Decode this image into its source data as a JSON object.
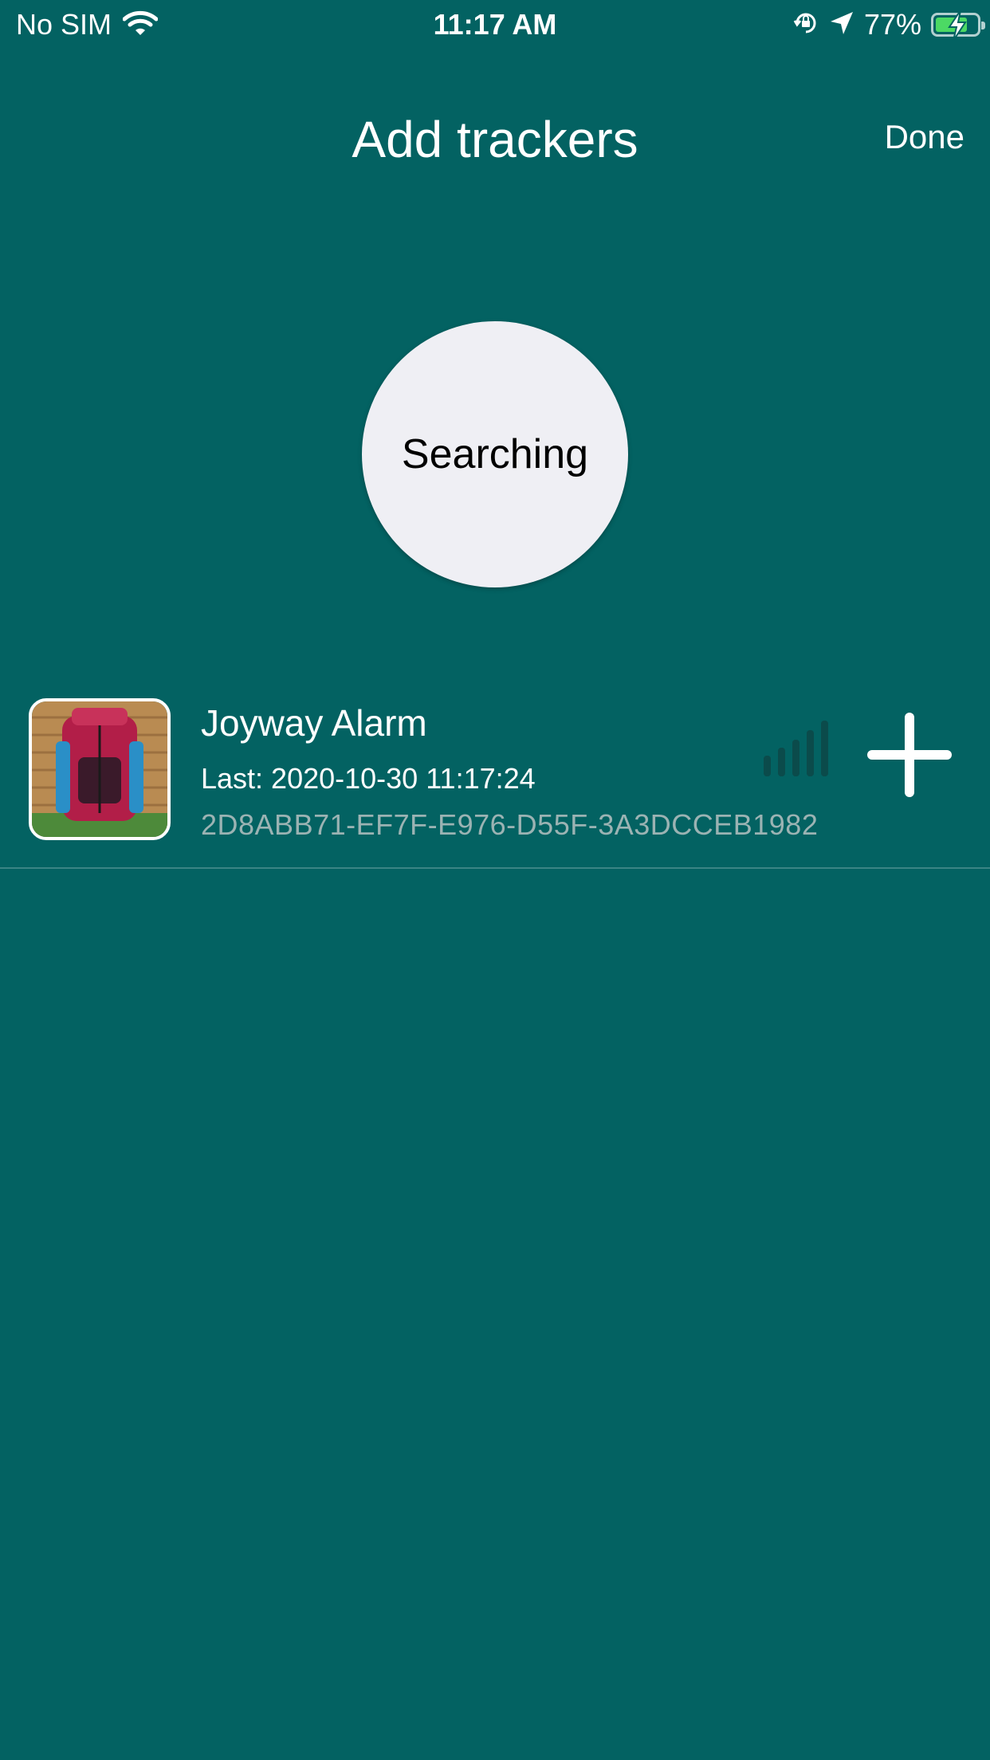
{
  "status_bar": {
    "carrier": "No SIM",
    "time": "11:17 AM",
    "battery_percent": "77%"
  },
  "nav": {
    "title": "Add trackers",
    "done_label": "Done"
  },
  "search": {
    "label": "Searching"
  },
  "trackers": [
    {
      "name": "Joyway Alarm",
      "last_seen": "Last: 2020-10-30 11:17:24",
      "id": "2D8ABB71-EF7F-E976-D55F-3A3DCCEB1982",
      "signal_bars": 0
    }
  ],
  "colors": {
    "background": "#036262",
    "circle": "#efeff4",
    "secondary_text": "#9bb3b3"
  },
  "icons": [
    "wifi-icon",
    "orientation-lock-icon",
    "location-arrow-icon",
    "battery-icon",
    "signal-strength-icon",
    "plus-icon"
  ]
}
